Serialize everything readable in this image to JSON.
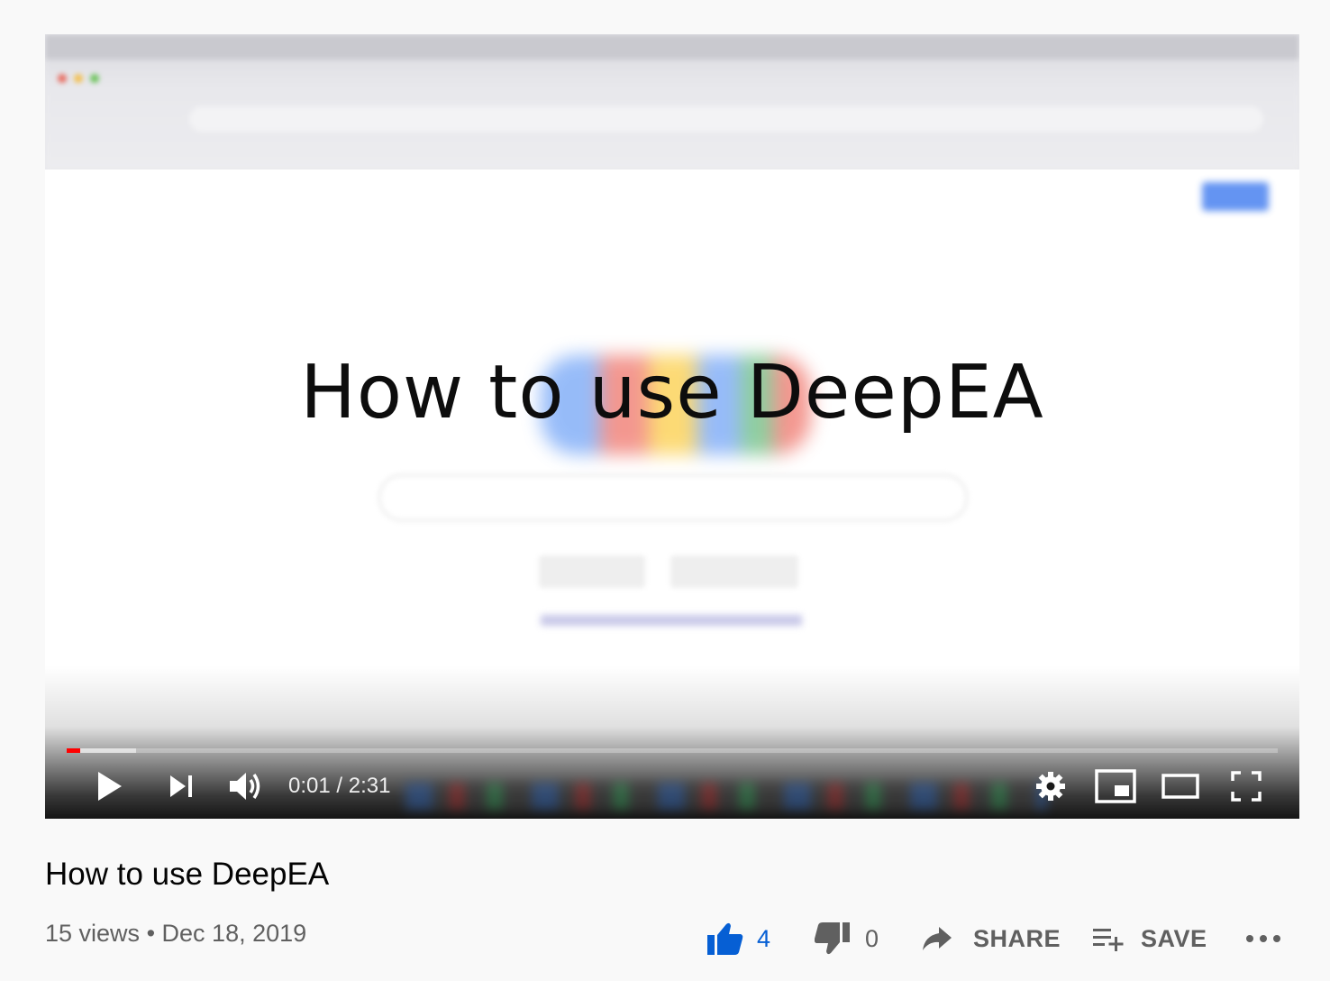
{
  "video": {
    "overlay_title": "How to use DeepEA",
    "progress_played_fraction": 0.011,
    "progress_loaded_fraction": 0.057,
    "time_current": "0:01",
    "time_separator": "/",
    "time_total": "2:31",
    "icons": {
      "play": "play-icon",
      "next": "skip-next-icon",
      "volume": "volume-icon",
      "settings": "gear-icon",
      "miniplayer": "miniplayer-icon",
      "theater": "theater-mode-icon",
      "fullscreen": "fullscreen-icon"
    }
  },
  "info": {
    "title": "How to use DeepEA",
    "views": "15 views",
    "bullet": "•",
    "date": "Dec 18, 2019"
  },
  "actions": {
    "likes": "4",
    "dislikes": "0",
    "share_label": "SHARE",
    "save_label": "SAVE",
    "like_color": "#065fd4",
    "muted_color": "#606060"
  },
  "colors": {
    "progress": "#ff0000",
    "page_background": "#f9f9f9"
  }
}
